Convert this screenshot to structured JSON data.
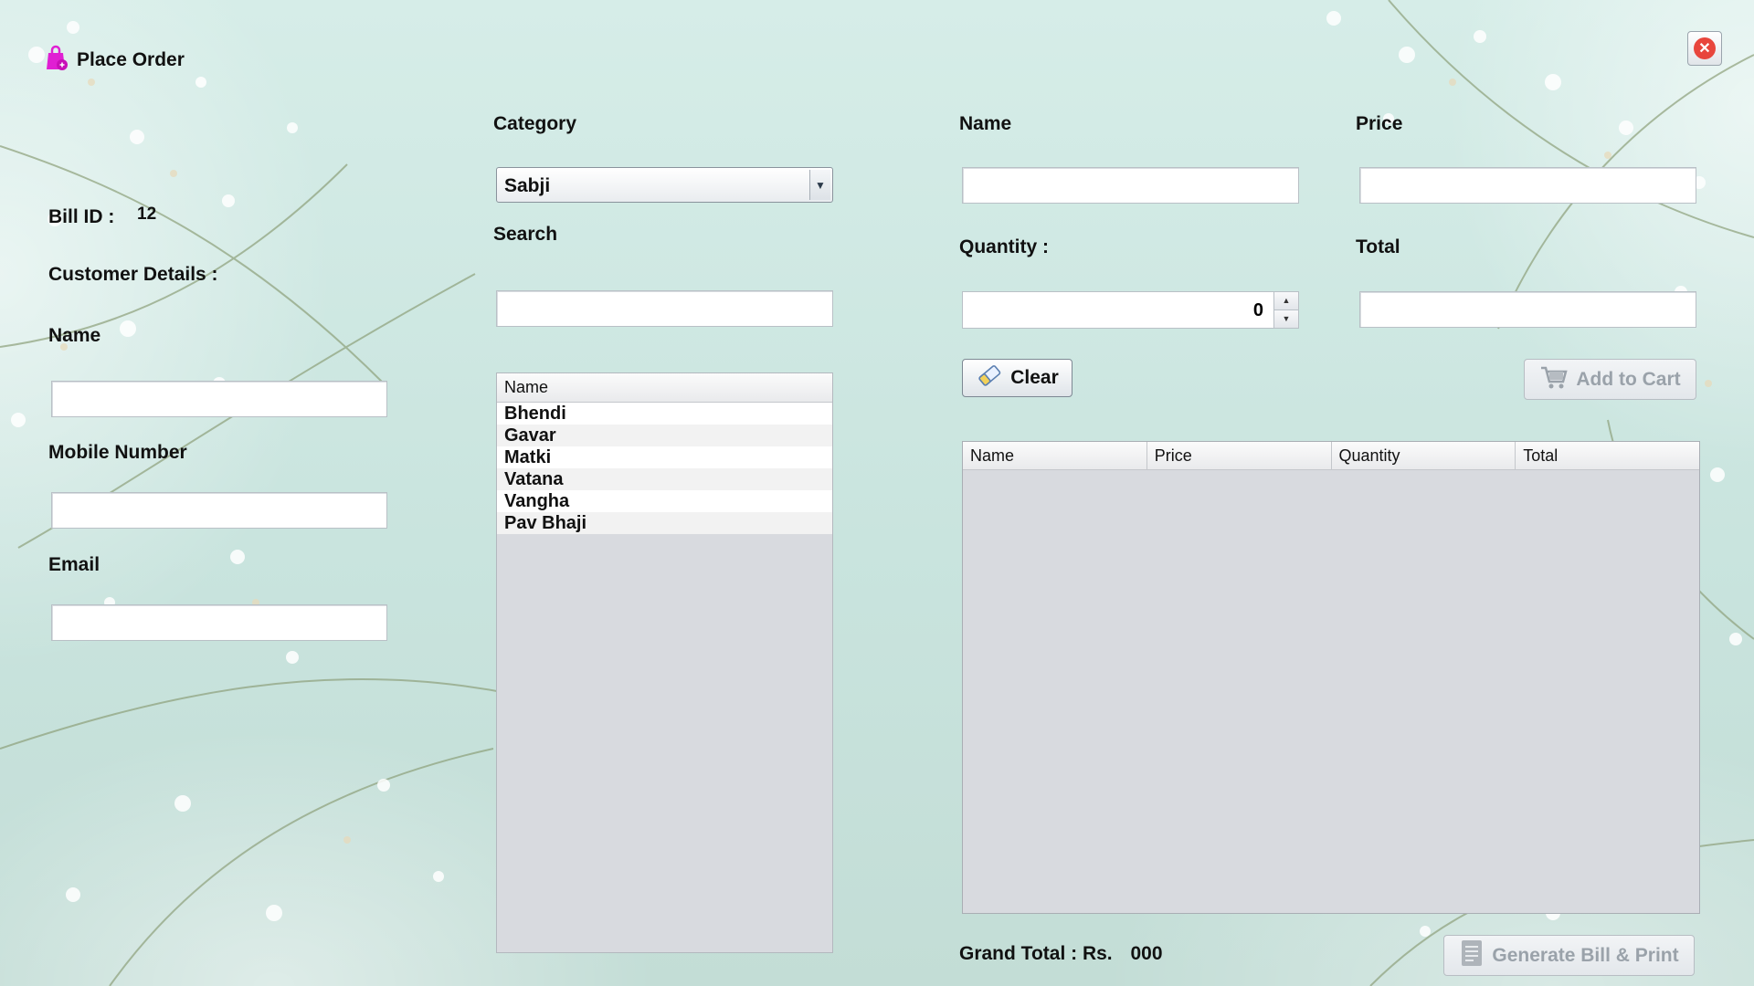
{
  "window": {
    "title": "Place Order",
    "title_icon": "shopping-bag-icon",
    "close_icon": "close-icon"
  },
  "customer": {
    "bill_id_label": "Bill ID :",
    "bill_id_value": "12",
    "section_title": "Customer Details :",
    "name_label": "Name",
    "name_value": "",
    "mobile_label": "Mobile Number",
    "mobile_value": "",
    "email_label": "Email",
    "email_value": ""
  },
  "product": {
    "category_label": "Category",
    "category_selected": "Sabji",
    "search_label": "Search",
    "search_value": "",
    "list_header": "Name",
    "items": [
      "Bhendi",
      "Gavar",
      "Matki",
      "Vatana",
      "Vangha",
      "Pav Bhaji"
    ]
  },
  "detail": {
    "name_label": "Name",
    "name_value": "",
    "price_label": "Price",
    "price_value": "",
    "quantity_label": "Quantity :",
    "quantity_value": "0",
    "total_label": "Total",
    "total_value": "",
    "clear_label": "Clear",
    "add_to_cart_label": "Add to Cart"
  },
  "cart": {
    "columns": [
      "Name",
      "Price",
      "Quantity",
      "Total"
    ],
    "rows": []
  },
  "footer": {
    "grand_total_label": "Grand Total : Rs.",
    "grand_total_value": "000",
    "generate_label": "Generate Bill & Print"
  },
  "colors": {
    "accent_bag": "#e01fd3",
    "close_red": "#e8453c",
    "background": "#cfe8e2"
  }
}
